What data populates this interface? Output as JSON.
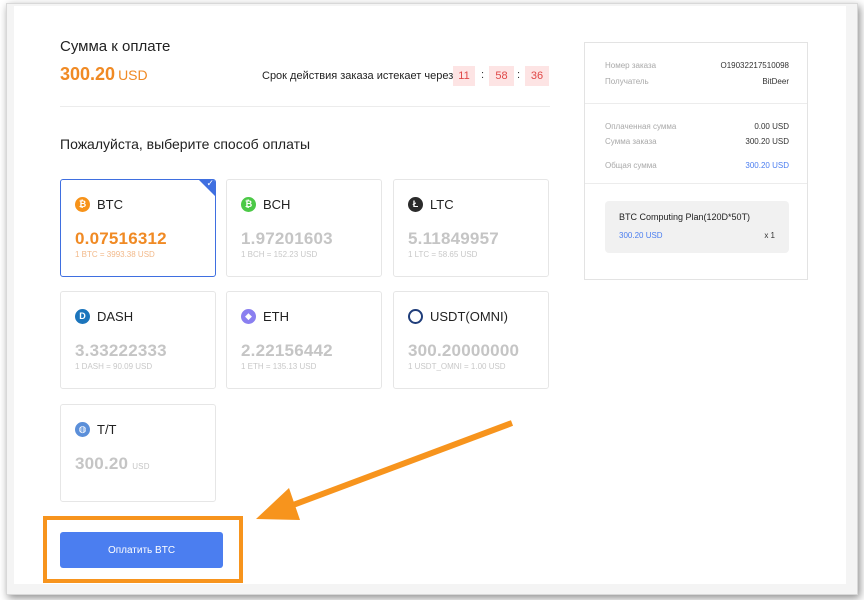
{
  "header": {
    "sum_label": "Сумма к оплате",
    "sum_value": "300.20",
    "sum_currency": "USD",
    "expire_text": "Срок действия заказа истекает через",
    "timer": {
      "hours": "11",
      "minutes": "58",
      "seconds": "36"
    }
  },
  "choose_title": "Пожалуйста, выберите способ оплаты",
  "methods": [
    {
      "name": "BTC",
      "amount": "0.07516312",
      "rate": "1 BTC = 3993.38 USD",
      "icon": "bitcoin-icon",
      "color": "#f7931a",
      "selected": true
    },
    {
      "name": "BCH",
      "amount": "1.97201603",
      "rate": "1 BCH = 152.23 USD",
      "icon": "bitcoin-cash-icon",
      "color": "#4cc947",
      "selected": false
    },
    {
      "name": "LTC",
      "amount": "5.11849957",
      "rate": "1 LTC = 58.65 USD",
      "icon": "litecoin-icon",
      "color": "#2b2b2b",
      "selected": false
    },
    {
      "name": "DASH",
      "amount": "3.33222333",
      "rate": "1 DASH = 90.09 USD",
      "icon": "dash-icon",
      "color": "#1c75bc",
      "selected": false
    },
    {
      "name": "ETH",
      "amount": "2.22156442",
      "rate": "1 ETH = 135.13 USD",
      "icon": "ethereum-icon",
      "color": "#8a7ff0",
      "selected": false
    },
    {
      "name": "USDT(OMNI)",
      "amount": "300.20000000",
      "rate": "1 USDT_OMNI = 1.00 USD",
      "icon": "tether-omni-icon",
      "color": "#1f3d7a",
      "selected": false
    },
    {
      "name": "T/T",
      "amount": "300.20",
      "amount_unit": "USD",
      "rate": "",
      "icon": "bank-transfer-icon",
      "color": "#5b8fd9",
      "selected": false
    }
  ],
  "pay_button": "Оплатить BTC",
  "summary": {
    "order_no_label": "Номер заказа",
    "order_no": "O19032217510098",
    "recipient_label": "Получатель",
    "recipient": "BitDeer",
    "paid_label": "Оплаченная сумма",
    "paid": "0.00 USD",
    "order_sum_label": "Сумма заказа",
    "order_sum": "300.20 USD",
    "total_label": "Общая сумма",
    "total": "300.20 USD",
    "plan_name": "BTC Computing Plan(120D*50T)",
    "plan_price": "300.20 USD",
    "plan_qty": "x 1"
  },
  "colors": {
    "accent": "#4b7ef0",
    "orange": "#f08a24",
    "annotation": "#f7941d"
  }
}
